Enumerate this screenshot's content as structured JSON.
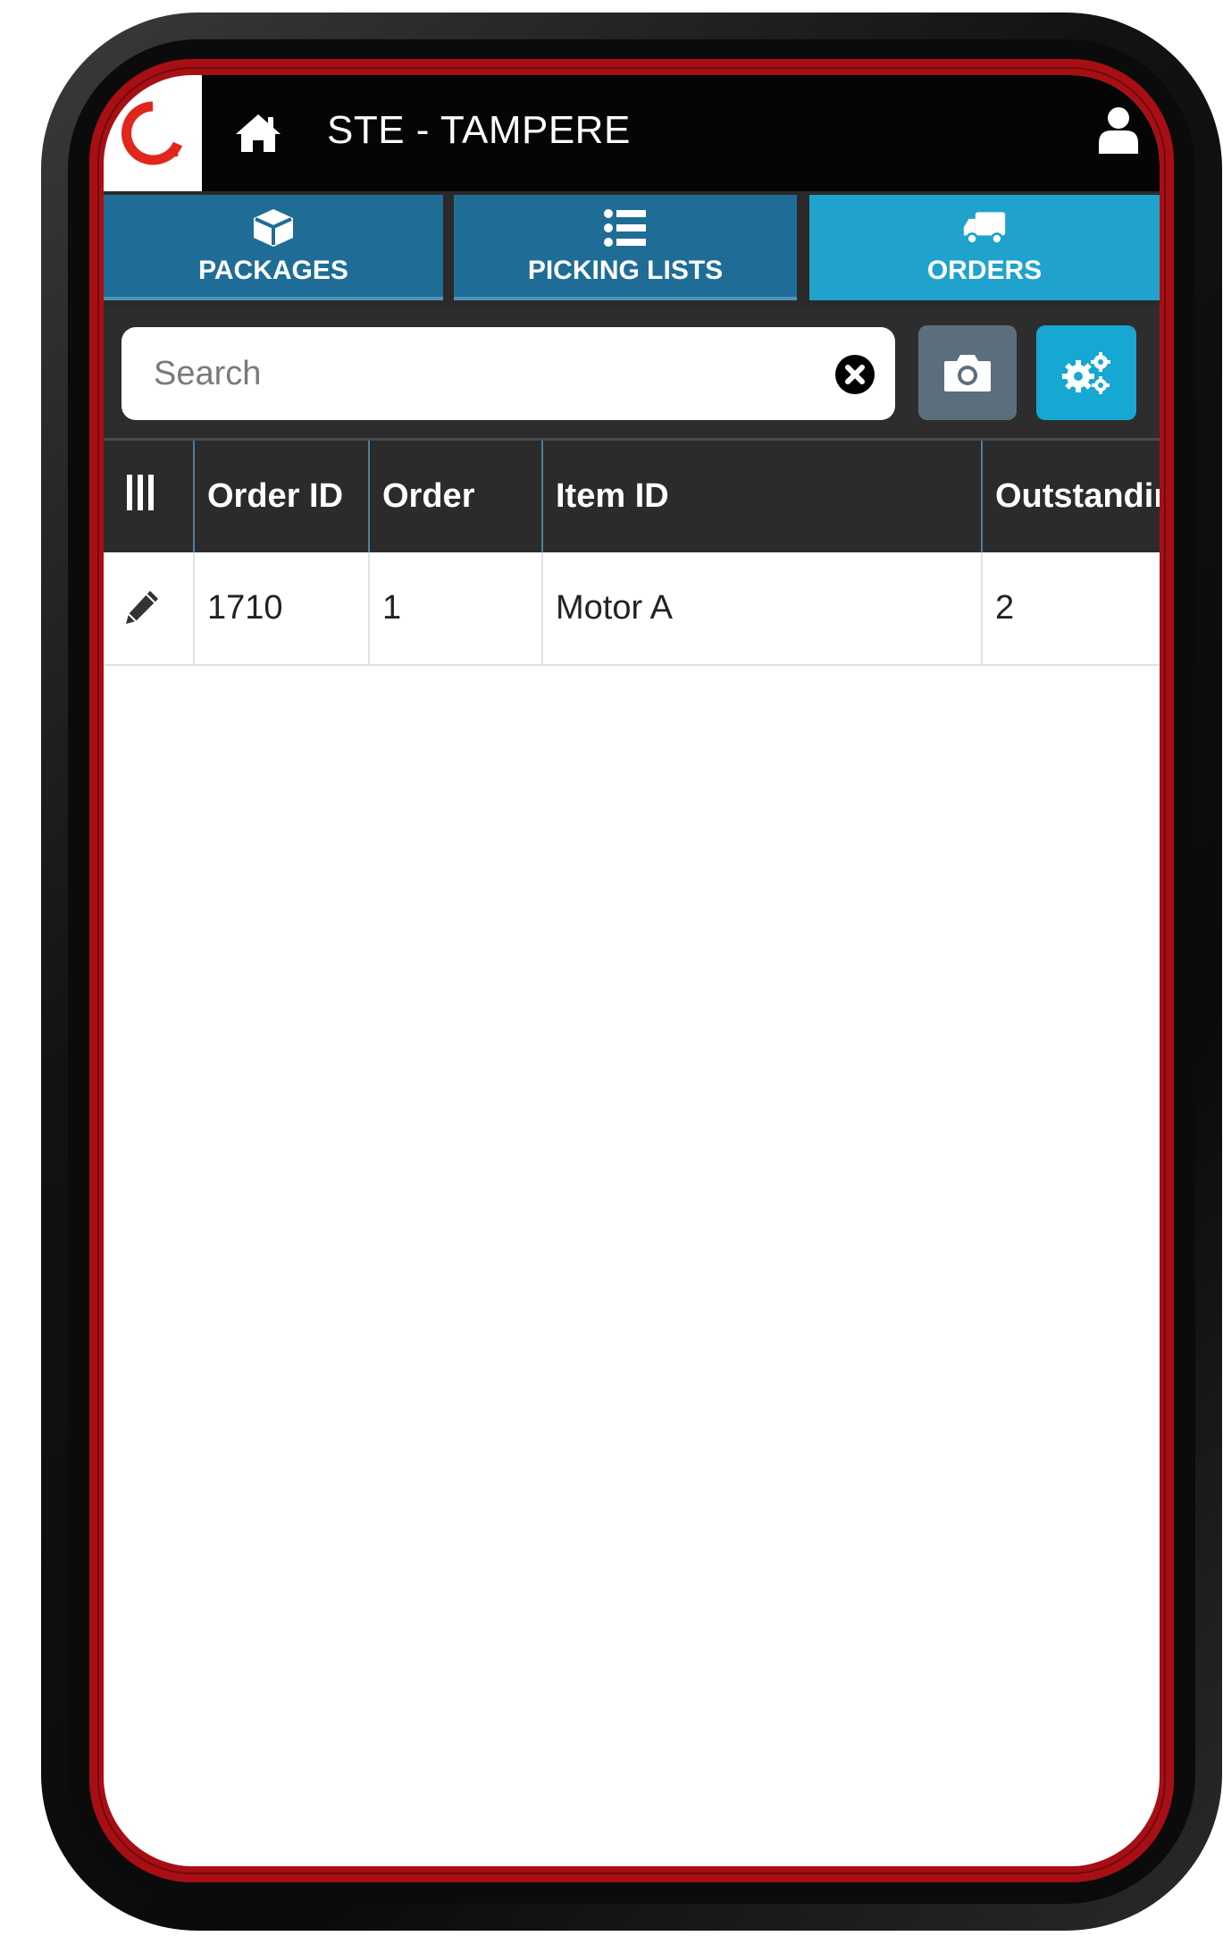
{
  "header": {
    "title": "STE - TAMPERE",
    "logo_icon": "spinner-logo-icon",
    "home_icon": "home-icon",
    "user_icon": "user-icon",
    "brand_color": "#e1261c"
  },
  "tabs": [
    {
      "label": "PACKAGES",
      "icon": "box-icon",
      "active": false
    },
    {
      "label": "PICKING LISTS",
      "icon": "list-icon",
      "active": false
    },
    {
      "label": "ORDERS",
      "icon": "truck-icon",
      "active": true
    }
  ],
  "search": {
    "placeholder": "Search",
    "value": "",
    "clear_icon": "clear-circle-icon",
    "camera_icon": "camera-icon",
    "settings_icon": "cogs-icon"
  },
  "table": {
    "columns_icon": "columns-icon",
    "headers": [
      "Order ID",
      "Order",
      "Item ID",
      "Outstanding"
    ],
    "rows": [
      {
        "edit_icon": "pencil-icon",
        "cells": [
          "1710",
          "1",
          "Motor A",
          "2"
        ]
      }
    ]
  },
  "colors": {
    "header_bg": "#050505",
    "tab_bg": "#1f6d96",
    "tab_active_bg": "#1fa3cc",
    "settings_button_bg": "#17a7d3",
    "camera_button_bg": "#5b6e7c",
    "device_rim": "#a80f14"
  }
}
